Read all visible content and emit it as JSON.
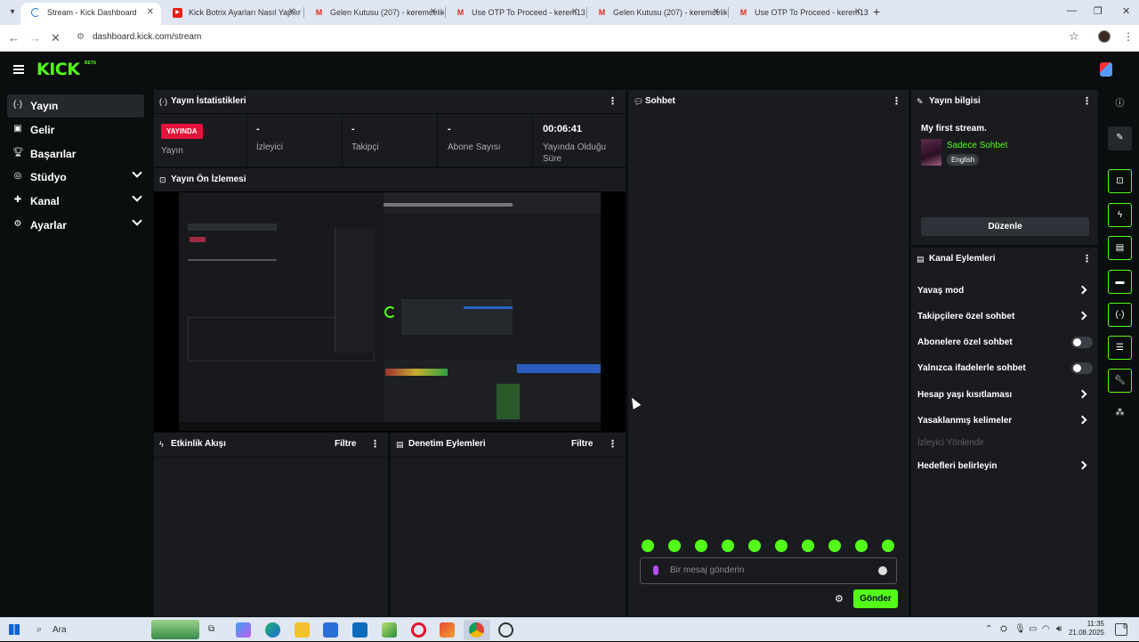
{
  "browser": {
    "tabs": [
      {
        "title": "Stream - Kick Dashboard",
        "icon": "loading-spinner-icon"
      },
      {
        "title": "Kick Botrix Ayarları Nasıl Yapılır",
        "icon": "youtube-icon"
      },
      {
        "title": "Gelen Kutusu (207) - keremcelik",
        "icon": "gmail-icon"
      },
      {
        "title": "Use OTP To Proceed - kerem13",
        "icon": "gmail-icon"
      },
      {
        "title": "Gelen Kutusu (207) - keremcelik",
        "icon": "gmail-icon"
      },
      {
        "title": "Use OTP To Proceed - kerem13",
        "icon": "gmail-icon"
      }
    ],
    "url": "dashboard.kick.com/stream"
  },
  "header": {
    "logo": "KICK",
    "beta": "BETA"
  },
  "leftnav": {
    "items": [
      {
        "label": "Yayın",
        "icon": "broadcast-icon",
        "active": true,
        "expandable": false
      },
      {
        "label": "Gelir",
        "icon": "revenue-icon",
        "active": false,
        "expandable": false
      },
      {
        "label": "Başarılar",
        "icon": "trophy-icon",
        "active": false,
        "expandable": false
      },
      {
        "label": "Stüdyo",
        "icon": "studio-icon",
        "active": false,
        "expandable": true
      },
      {
        "label": "Kanal",
        "icon": "channel-icon",
        "active": false,
        "expandable": true
      },
      {
        "label": "Ayarlar",
        "icon": "gear-icon",
        "active": false,
        "expandable": true
      }
    ]
  },
  "stats": {
    "title": "Yayın İstatistikleri",
    "live_badge": "YAYINDA",
    "live_label": "Yayın",
    "viewers": {
      "value": "-",
      "label": "İzleyici"
    },
    "followers": {
      "value": "-",
      "label": "Takipçi"
    },
    "subs": {
      "value": "-",
      "label": "Abone Sayısı"
    },
    "uptime": {
      "value": "00:06:41",
      "label_1": "Yayında Olduğu",
      "label_2": "Süre"
    }
  },
  "preview": {
    "title": "Yayın Ön İzlemesi"
  },
  "activity": {
    "title": "Etkinlik Akışı",
    "filter": "Filtre"
  },
  "moderation": {
    "title": "Denetim Eylemleri",
    "filter": "Filtre"
  },
  "chat": {
    "title": "Sohbet",
    "placeholder": "Bir mesaj gönderin",
    "send": "Gönder",
    "emote_count": 10
  },
  "stream_info": {
    "title": "Yayın bilgisi",
    "stream_title": "My first stream.",
    "category": "Sadece Sohbet",
    "language": "English",
    "edit": "Düzenle"
  },
  "channel_actions": {
    "title": "Kanal Eylemleri",
    "items": [
      {
        "label": "Yavaş mod",
        "control": "chevron"
      },
      {
        "label": "Takipçilere özel sohbet",
        "control": "chevron"
      },
      {
        "label": "Abonelere özel sohbet",
        "control": "toggle",
        "on": false
      },
      {
        "label": "Yalnızca ifadelerle sohbet",
        "control": "toggle",
        "on": false
      },
      {
        "label": "Hesap yaşı kısıtlaması",
        "control": "chevron"
      },
      {
        "label": "Yasaklanmış kelimeler",
        "control": "chevron"
      },
      {
        "label": "İzleyici Yönlendir",
        "control": "disabled"
      },
      {
        "label": "Hedefleri belirleyin",
        "control": "chevron"
      }
    ]
  },
  "taskbar": {
    "search": "Ara",
    "time": "11:35",
    "date": "21.08.2025",
    "notifications": "6"
  },
  "colors": {
    "accent": "#53fc18",
    "live": "#e5133a",
    "panel": "#191b1f",
    "background": "#0b0e0f"
  }
}
